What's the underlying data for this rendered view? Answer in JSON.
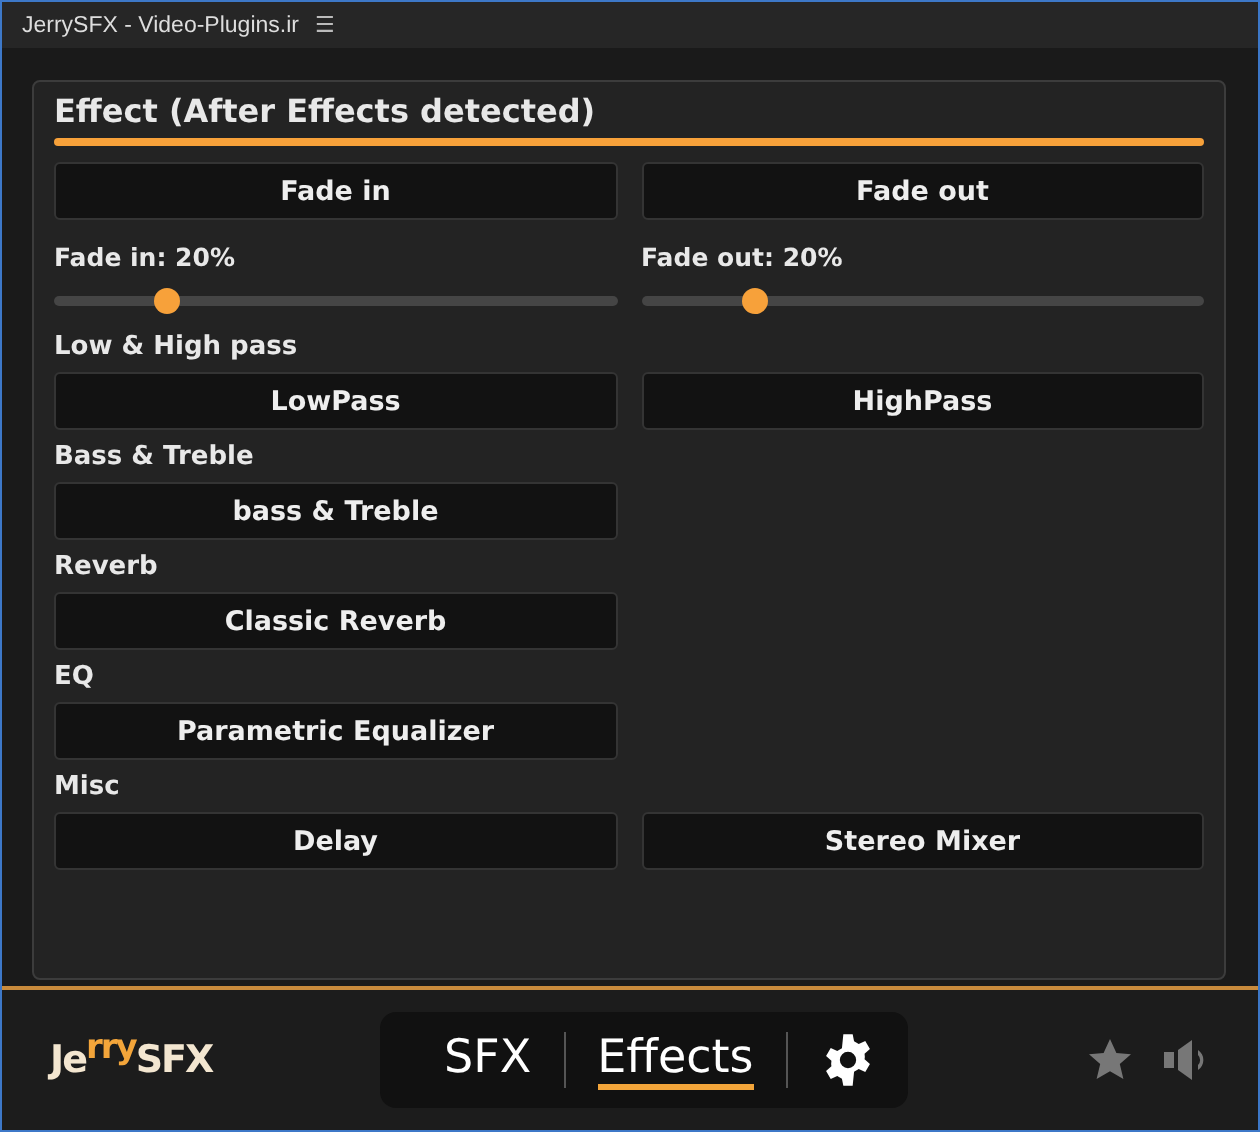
{
  "window": {
    "title": "JerrySFX - Video-Plugins.ir",
    "menu_glyph": "☰"
  },
  "panel": {
    "title": "Effect (After Effects detected)",
    "rows": [
      {
        "kind": "buttons",
        "buttons": [
          "Fade in",
          "Fade out"
        ]
      },
      {
        "kind": "sliders",
        "sliders": [
          {
            "label": "Fade in: 20%",
            "level": 0.2
          },
          {
            "label": "Fade out: 20%",
            "level": 0.2
          }
        ]
      },
      {
        "kind": "heading",
        "text": "Low & High pass"
      },
      {
        "kind": "buttons",
        "buttons": [
          "LowPass",
          "HighPass"
        ]
      },
      {
        "kind": "heading",
        "text": "Bass & Treble"
      },
      {
        "kind": "buttons",
        "buttons": [
          "bass & Treble"
        ]
      },
      {
        "kind": "heading",
        "text": "Reverb"
      },
      {
        "kind": "buttons",
        "buttons": [
          "Classic Reverb"
        ]
      },
      {
        "kind": "heading",
        "text": "EQ"
      },
      {
        "kind": "buttons",
        "buttons": [
          "Parametric Equalizer"
        ]
      },
      {
        "kind": "heading",
        "text": "Misc"
      },
      {
        "kind": "buttons",
        "buttons": [
          "Delay",
          "Stereo Mixer"
        ]
      }
    ]
  },
  "footer": {
    "logo": [
      {
        "text": "Je",
        "accent": false
      },
      {
        "text": "rry",
        "accent": true
      },
      {
        "text": "SFX",
        "accent": false
      }
    ],
    "nav": [
      {
        "label": "SFX",
        "selected": false
      },
      {
        "label": "Effects",
        "selected": true
      }
    ]
  }
}
